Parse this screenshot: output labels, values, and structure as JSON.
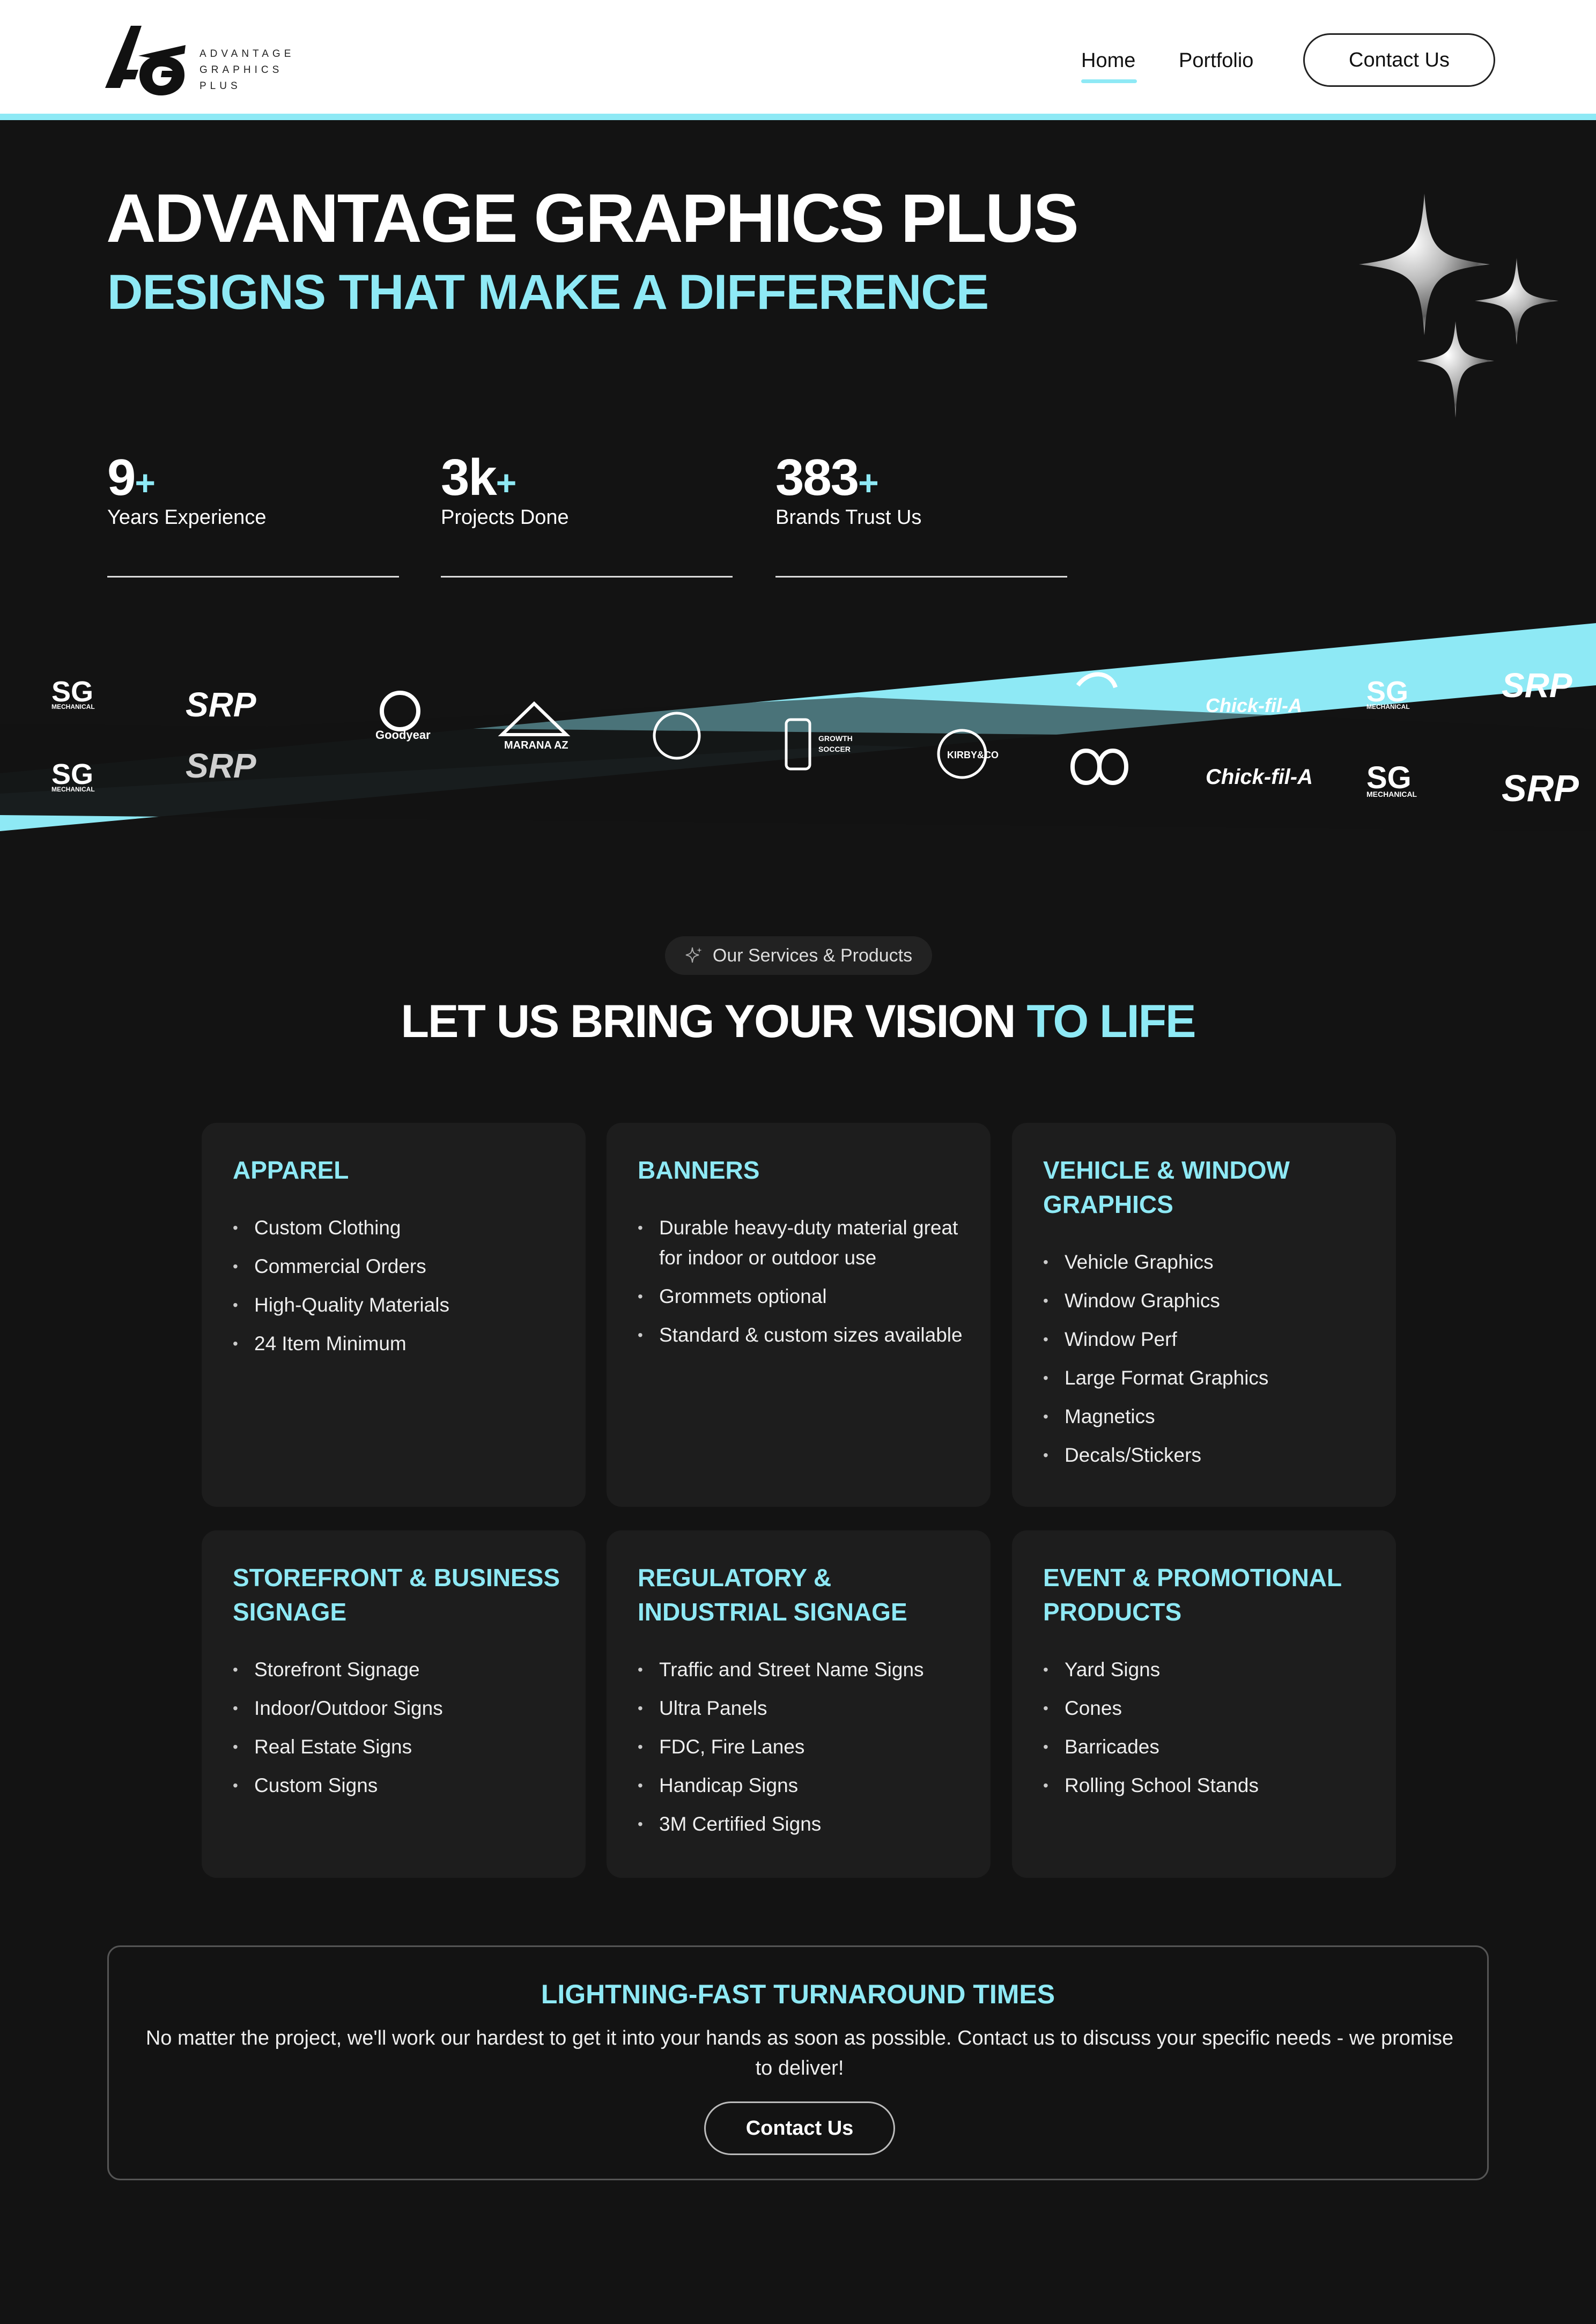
{
  "header": {
    "logo_monogram": "AG",
    "logo_text_line1": "ADVANTAGE",
    "logo_text_line2": "GRAPHICS PLUS",
    "nav": {
      "home": "Home",
      "portfolio": "Portfolio",
      "contact": "Contact Us"
    }
  },
  "hero": {
    "title": "ADVANTAGE GRAPHICS PLUS",
    "subtitle": "DESIGNS THAT MAKE A DIFFERENCE",
    "sparkle_icon": "sparkles-icon",
    "stats": [
      {
        "value": "9",
        "suffix": "+",
        "label": "Years Experience"
      },
      {
        "value": "3k",
        "suffix": "+",
        "label": "Projects Done"
      },
      {
        "value": "383",
        "suffix": "+",
        "label": "Brands Trust Us"
      }
    ]
  },
  "brand_band": {
    "logos": [
      "SG MECHANICAL",
      "SRP",
      "Goodyear",
      "MARANA AZ",
      "seal",
      "GROWTH SOCCER TRAINING",
      "KIRBY & CO",
      "infinity",
      "Chick-fil-A",
      "SG MECHANICAL",
      "SRP"
    ],
    "accent_color": "#8ee9f5"
  },
  "services": {
    "pill_label": "Our Services & Products",
    "title_part1": "LET US BRING YOUR VISION ",
    "title_part2": "TO LIFE",
    "cards": [
      {
        "title": "APPAREL",
        "items": [
          "Custom Clothing",
          "Commercial Orders",
          "High-Quality Materials",
          "24 Item Minimum"
        ]
      },
      {
        "title": "BANNERS",
        "items": [
          "Durable heavy-duty material great for indoor or outdoor use",
          "Grommets optional",
          "Standard & custom sizes available"
        ]
      },
      {
        "title": "VEHICLE & WINDOW GRAPHICS",
        "items": [
          "Vehicle Graphics",
          "Window Graphics",
          "Window Perf",
          "Large Format Graphics",
          "Magnetics",
          "Decals/Stickers"
        ]
      },
      {
        "title": "STOREFRONT & BUSINESS SIGNAGE",
        "items": [
          "Storefront Signage",
          "Indoor/Outdoor Signs",
          "Real Estate Signs",
          "Custom Signs"
        ]
      },
      {
        "title": "REGULATORY & INDUSTRIAL SIGNAGE",
        "items": [
          "Traffic and Street Name Signs",
          "Ultra Panels",
          "FDC, Fire Lanes",
          "Handicap Signs",
          "3M Certified Signs"
        ]
      },
      {
        "title": "EVENT & PROMOTIONAL PRODUCTS",
        "items": [
          "Yard Signs",
          "Cones",
          "Barricades",
          "Rolling School Stands"
        ]
      }
    ]
  },
  "turnaround": {
    "title": "LIGHTNING-FAST TURNAROUND TIMES",
    "text": "No matter the project, we'll work our hardest to get it into your hands as soon as possible. Contact us to discuss your specific needs - we promise to deliver!",
    "button": "Contact Us"
  },
  "colors": {
    "accent": "#8ee9f5",
    "background": "#131313",
    "card": "#1d1d1d"
  }
}
